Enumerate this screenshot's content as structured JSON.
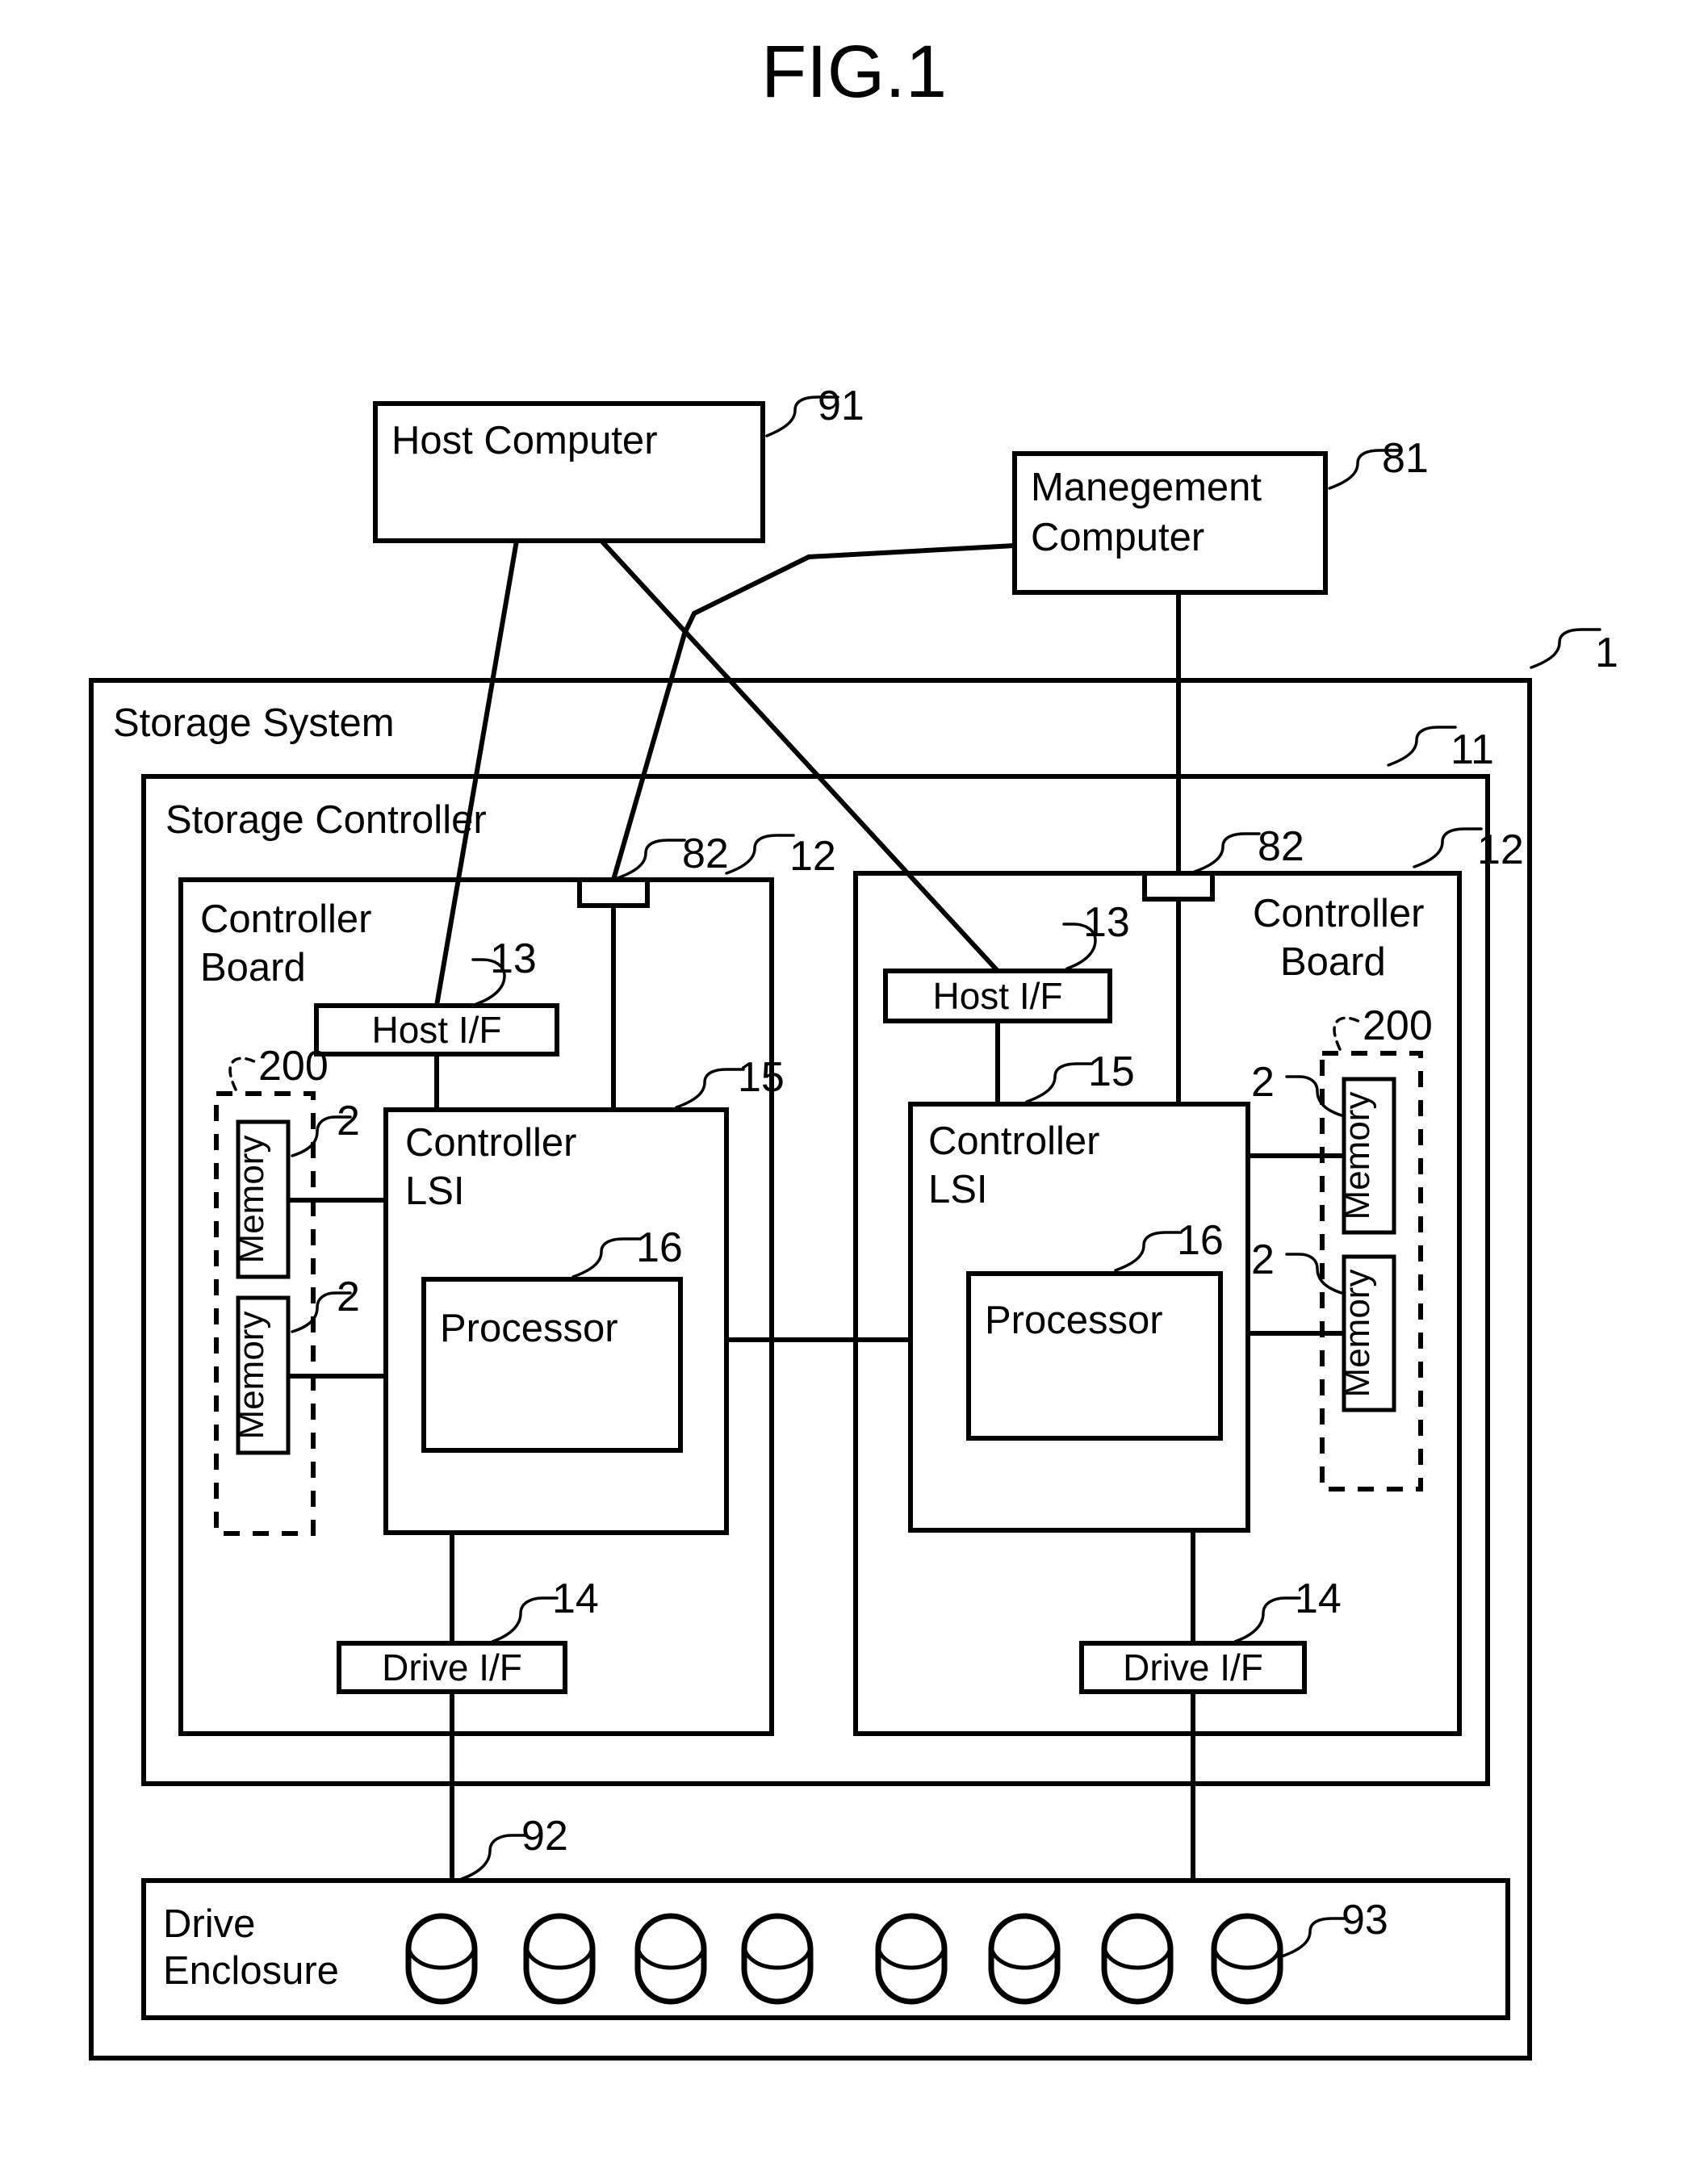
{
  "figure": {
    "title": "FIG.1"
  },
  "blocks": {
    "host_computer": {
      "label": "Host Computer",
      "ref": "91"
    },
    "management_computer": {
      "label_line1": "Manegement",
      "label_line2": "Computer",
      "ref": "81"
    },
    "storage_system": {
      "label": "Storage System",
      "ref": "1"
    },
    "storage_controller": {
      "label": "Storage Controller",
      "ref": "11"
    },
    "drive_enclosure": {
      "label_line1": "Drive",
      "label_line2": "Enclosure",
      "ref": "92",
      "drive_ref": "93",
      "drive_count": 8
    }
  },
  "controller_boards": [
    {
      "side": "left",
      "label_line1": "Controller",
      "label_line2": "Board",
      "ref": "12",
      "mgmt_port_ref": "82",
      "host_if": {
        "label": "Host I/F",
        "ref": "13"
      },
      "controller_lsi": {
        "label_line1": "Controller",
        "label_line2": "LSI",
        "ref": "15"
      },
      "processor": {
        "label": "Processor",
        "ref": "16"
      },
      "drive_if": {
        "label": "Drive I/F",
        "ref": "14"
      },
      "memory_group": {
        "ref": "200"
      },
      "memories": [
        {
          "label": "Memory",
          "ref": "2"
        },
        {
          "label": "Memory",
          "ref": "2"
        }
      ]
    },
    {
      "side": "right",
      "label_line1": "Controller",
      "label_line2": "Board",
      "ref": "12",
      "mgmt_port_ref": "82",
      "host_if": {
        "label": "Host I/F",
        "ref": "13"
      },
      "controller_lsi": {
        "label_line1": "Controller",
        "label_line2": "LSI",
        "ref": "15"
      },
      "processor": {
        "label": "Processor",
        "ref": "16"
      },
      "drive_if": {
        "label": "Drive I/F",
        "ref": "14"
      },
      "memory_group": {
        "ref": "200"
      },
      "memories": [
        {
          "label": "Memory",
          "ref": "2"
        },
        {
          "label": "Memory",
          "ref": "2"
        }
      ]
    }
  ],
  "colors": {
    "ink": "#000000",
    "paper": "#ffffff"
  }
}
